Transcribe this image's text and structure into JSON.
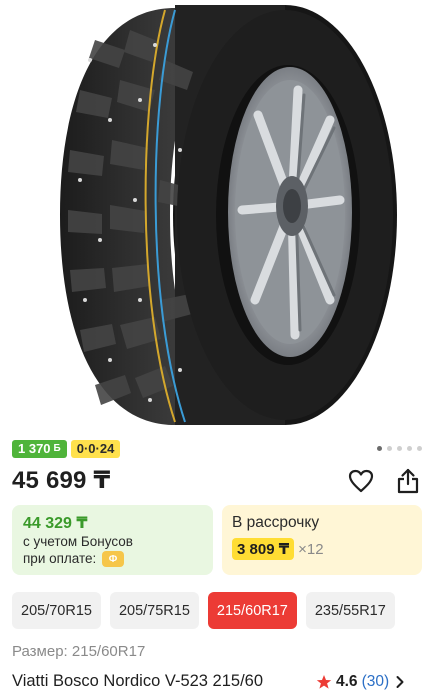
{
  "gallery": {
    "image_alt": "tire-product-photo",
    "dots_count": 5,
    "active_dot": 0
  },
  "badges": {
    "bonus_label": "1 370",
    "bonus_icon": "Б",
    "installment_label": "0·0·24"
  },
  "price": {
    "main": "45 699 ₸"
  },
  "bonus_card": {
    "price": "44 329 ₸",
    "line1": "с учетом Бонусов",
    "line2": "при оплате:",
    "chip": "Ф"
  },
  "installment_card": {
    "title": "В рассрочку",
    "amount": "3 809 ₸",
    "multiplier": "×12"
  },
  "sizes": [
    {
      "label": "205/70R15",
      "active": false
    },
    {
      "label": "205/75R15",
      "active": false
    },
    {
      "label": "215/60R17",
      "active": true
    },
    {
      "label": "235/55R17",
      "active": false
    }
  ],
  "size_info": "Размер: 215/60R17",
  "product": {
    "title": "Viatti Bosco Nordico V-523 215/60",
    "rating": "4.6",
    "reviews": "(30)"
  },
  "colors": {
    "accent_red": "#ec3b35",
    "bonus_green": "#4fb43a",
    "installment_yellow": "#ffdd33"
  },
  "icons": [
    "heart-icon",
    "share-icon",
    "star-icon",
    "chevron-right-icon"
  ]
}
